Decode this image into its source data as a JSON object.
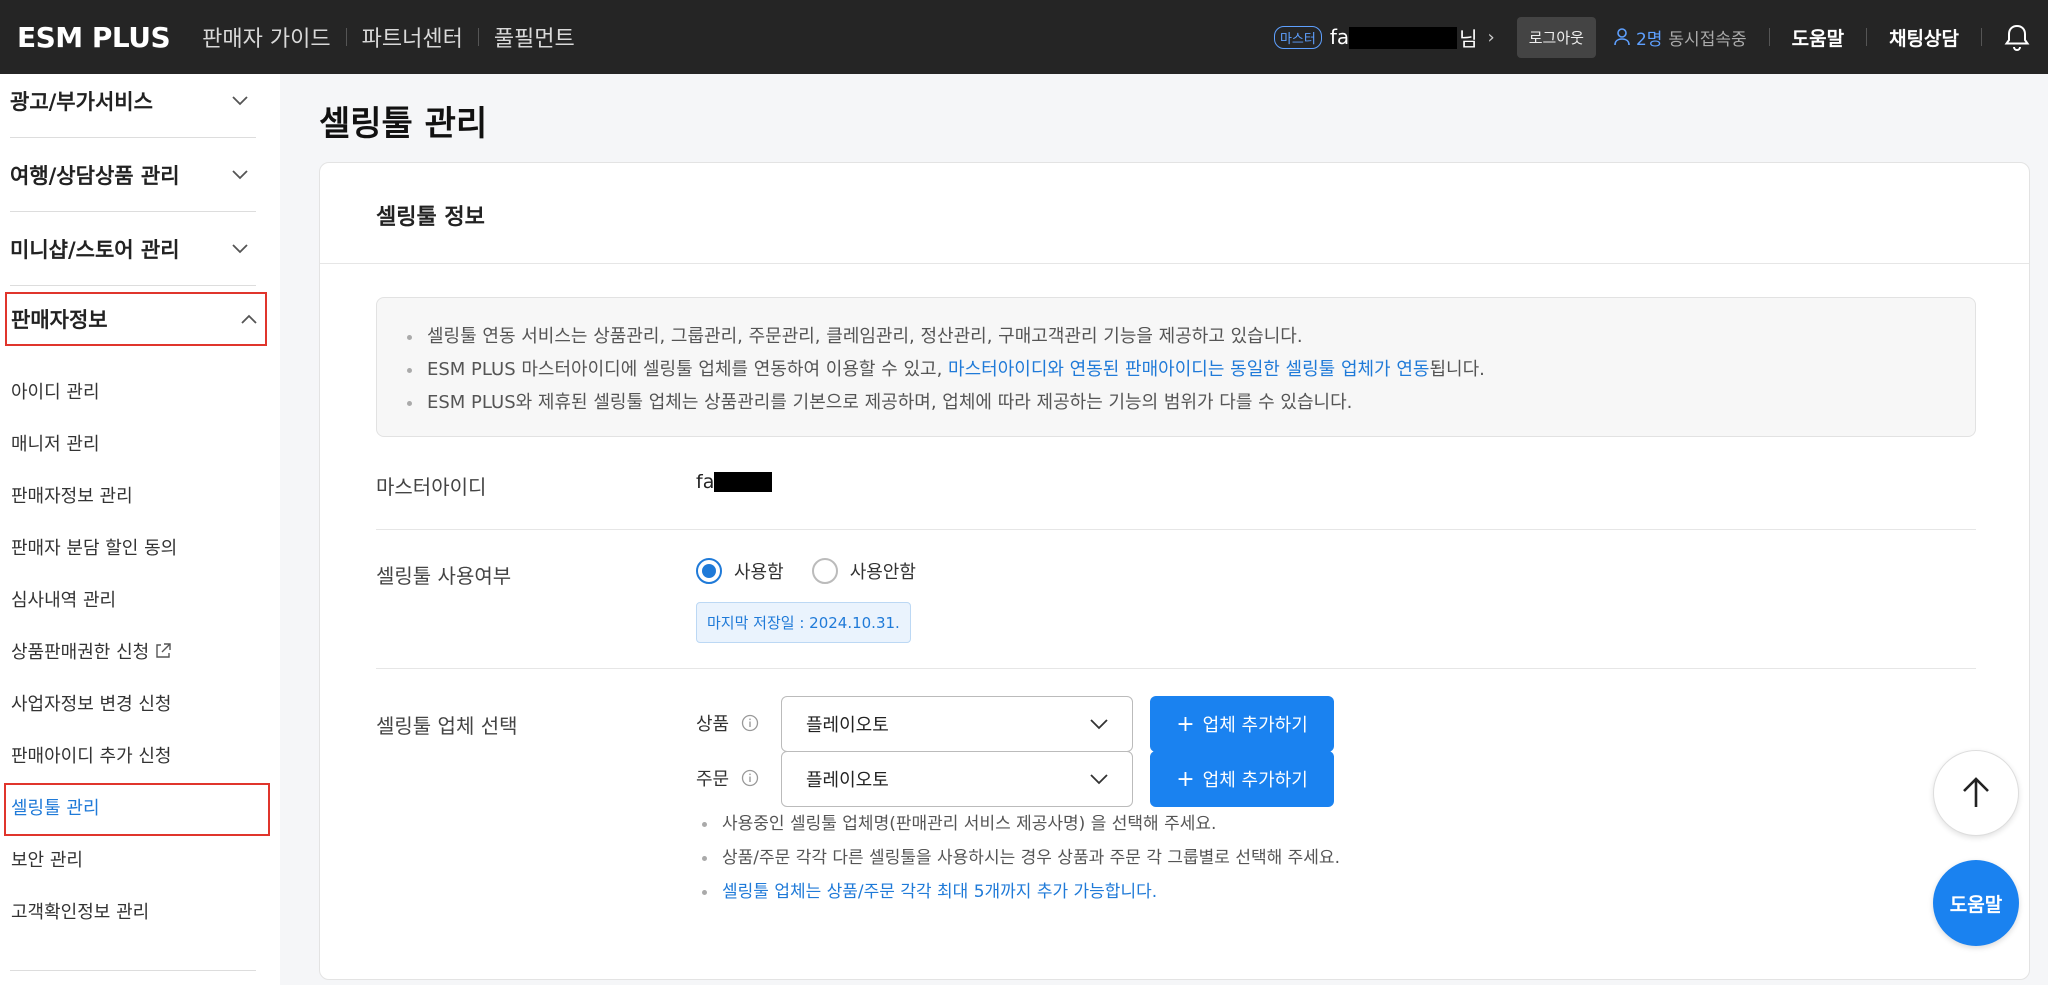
{
  "header": {
    "logo": "ESM PLUS",
    "nav": [
      "판매자 가이드",
      "파트너센터",
      "풀필먼트"
    ],
    "master_badge": "마스터",
    "user_prefix": "fa",
    "user_suffix": "님",
    "logout": "로그아웃",
    "concurrent_count": "2명",
    "concurrent_label": "동시접속중",
    "help": "도움말",
    "chat": "채팅상담"
  },
  "sidebar": {
    "sections": [
      "광고/부가서비스",
      "여행/상담상품 관리",
      "미니샵/스토어 관리"
    ],
    "active_section": "판매자정보",
    "items": [
      "아이디 관리",
      "매니저 관리",
      "판매자정보 관리",
      "판매자 분담 할인 동의",
      "심사내역 관리",
      "상품판매권한 신청",
      "사업자정보 변경 신청",
      "판매아이디 추가 신청",
      "셀링툴 관리",
      "보안 관리",
      "고객확인정보 관리"
    ],
    "selected_item": "셀링툴 관리"
  },
  "main": {
    "page_title": "셀링툴 관리",
    "card_title": "셀링툴 정보",
    "notices": {
      "n1": "셀링툴 연동 서비스는 상품관리, 그룹관리, 주문관리, 클레임관리, 정산관리, 구매고객관리 기능을 제공하고 있습니다.",
      "n2_pre": "ESM PLUS 마스터아이디에 셀링툴 업체를 연동하여 이용할 수 있고, ",
      "n2_hl": "마스터아이디와 연동된 판매아이디는 동일한 셀링툴 업체가 연동",
      "n2_post": "됩니다.",
      "n3": "ESM PLUS와 제휴된 셀링툴 업체는 상품관리를 기본으로 제공하며, 업체에 따라 제공하는 기능의 범위가 다를 수 있습니다."
    },
    "master_id_label": "마스터아이디",
    "master_id_prefix": "fa",
    "usage_label": "셀링툴 사용여부",
    "usage_options": [
      "사용함",
      "사용안함"
    ],
    "usage_selected": "사용함",
    "last_saved": "마지막 저장일 : 2024.10.31.",
    "vendor_label": "셀링툴 업체 선택",
    "product_label": "상품",
    "product_vendor": "플레이오토",
    "order_label": "주문",
    "order_vendor": "플레이오토",
    "add_vendor": "업체 추가하기",
    "vendor_notes": [
      "사용중인 셀링툴 업체명(판매관리 서비스 제공사명) 을 선택해 주세요.",
      "상품/주문 각각 다른 셀링툴을 사용하시는 경우 상품과 주문 각 그룹별로 선택해 주세요.",
      "셀링툴 업체는 상품/주문 각각 최대 5개까지 추가 가능합니다."
    ]
  },
  "floating": {
    "help": "도움말"
  },
  "colors": {
    "header_bg": "#252525",
    "accent": "#1a82f0",
    "highlight_box": "#e0352c"
  }
}
